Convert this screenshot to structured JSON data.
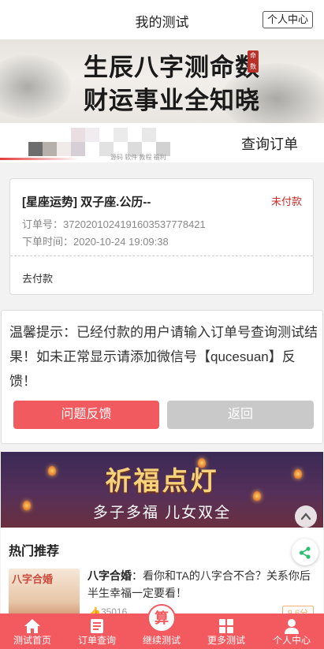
{
  "header": {
    "title": "我的测试",
    "user_center": "个人中心"
  },
  "banner": {
    "line1": "生辰八字测命数",
    "line2": "财运事业全知晓",
    "seal": "命数"
  },
  "tabs": {
    "query_label": "查询订单",
    "watermark": "源码 软件 教程 福利"
  },
  "order": {
    "title": "[星座运势] 双子座.公历--",
    "status": "未付款",
    "order_no_label": "订单号：",
    "order_no": "372020102419160353777842​1",
    "time_label": "下单时间：",
    "time": "2020-10-24 19:09:38",
    "pay_link": "去付款"
  },
  "notice": {
    "text": "温馨提示：已经付款的用户请输入订单号查询测试结果！如未正常显示请添加微信号【qucesuan】反馈！",
    "feedback_btn": "问题反馈",
    "back_btn": "返回"
  },
  "promo": {
    "title": "祈福点灯",
    "subtitle": "多子多福  儿女双全"
  },
  "hot": {
    "title": "热门推荐",
    "items": [
      {
        "thumb_text": "八字合婚",
        "name": "八字合婚",
        "desc": "：看你和TA的八字合不合？关系你后半生幸福一定要看！",
        "count": "35016",
        "tag": "9.6分"
      }
    ]
  },
  "nav": {
    "items": [
      {
        "label": "测试首页",
        "icon": "home-icon"
      },
      {
        "label": "订单查询",
        "icon": "order-list-icon"
      },
      {
        "label": "继续测试",
        "icon": "suan-badge-icon",
        "center_char": "算"
      },
      {
        "label": "更多测试",
        "icon": "grid-icon"
      },
      {
        "label": "个人中心",
        "icon": "user-icon"
      }
    ]
  },
  "colors": {
    "accent": "#f25a60",
    "unpaid": "#c9302c",
    "share": "#2fbf71"
  }
}
